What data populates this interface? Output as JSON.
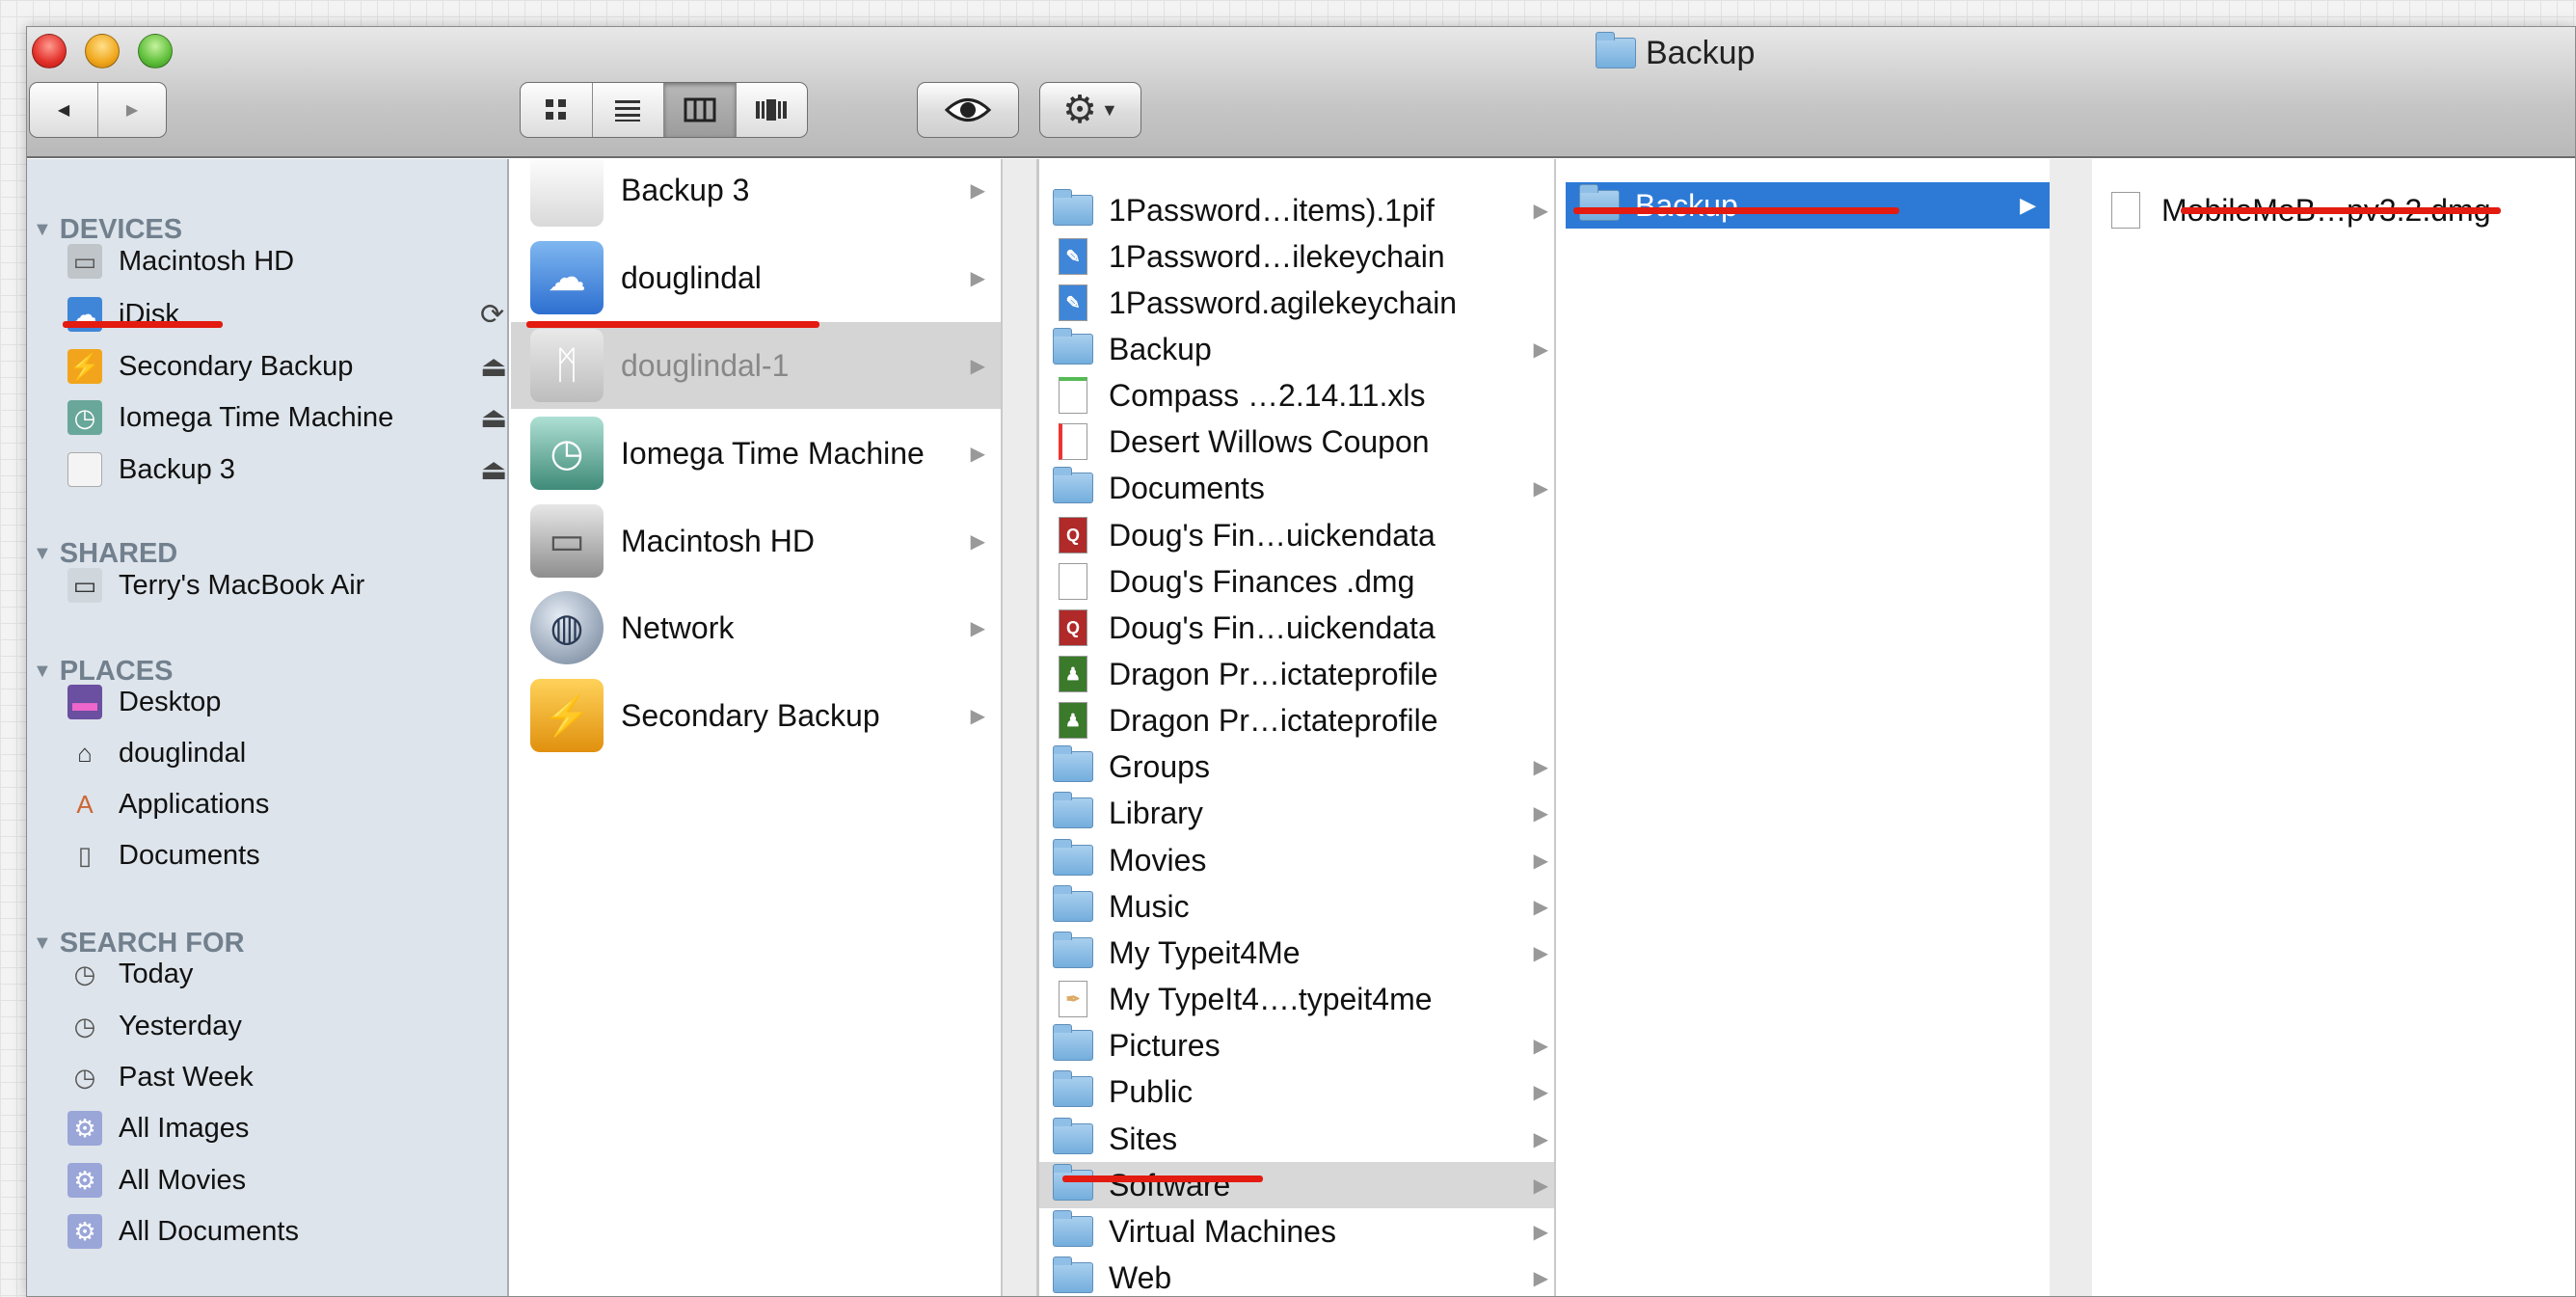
{
  "window": {
    "title": "Backup"
  },
  "toolbar": {
    "back_icon": "back-arrow-icon",
    "forward_icon": "forward-arrow-icon",
    "view_modes": [
      "icon-view",
      "list-view",
      "column-view",
      "coverflow-view"
    ],
    "quicklook_icon": "eye-icon",
    "action_icon": "gear-icon"
  },
  "sidebar": {
    "devices": {
      "header": "DEVICES",
      "items": [
        {
          "label": "Macintosh HD",
          "icon": "harddisk-icon"
        },
        {
          "label": "iDisk",
          "icon": "idisk-icon",
          "action": "⟳"
        },
        {
          "label": "Secondary Backup",
          "icon": "usb-drive-icon",
          "action": "⏏"
        },
        {
          "label": "Iomega Time Machine",
          "icon": "timemachine-drive-icon",
          "action": "⏏"
        },
        {
          "label": "Backup 3",
          "icon": "drive-icon",
          "action": "⏏"
        }
      ]
    },
    "shared": {
      "header": "SHARED",
      "items": [
        {
          "label": "Terry's MacBook Air",
          "icon": "laptop-icon"
        }
      ]
    },
    "places": {
      "header": "PLACES",
      "items": [
        {
          "label": "Desktop",
          "icon": "desktop-icon"
        },
        {
          "label": "douglindal",
          "icon": "home-icon"
        },
        {
          "label": "Applications",
          "icon": "applications-icon"
        },
        {
          "label": "Documents",
          "icon": "documents-icon"
        }
      ]
    },
    "search": {
      "header": "SEARCH FOR",
      "items": [
        {
          "label": "Today",
          "icon": "clock-icon"
        },
        {
          "label": "Yesterday",
          "icon": "clock-icon"
        },
        {
          "label": "Past Week",
          "icon": "clock-icon"
        },
        {
          "label": "All Images",
          "icon": "smart-folder-icon"
        },
        {
          "label": "All Movies",
          "icon": "smart-folder-icon"
        },
        {
          "label": "All Documents",
          "icon": "smart-folder-icon"
        }
      ]
    }
  },
  "column1": [
    {
      "label": "Backup 3",
      "icon": "drive-icon"
    },
    {
      "label": "douglindal",
      "icon": "idisk-icon"
    },
    {
      "label": "douglindal-1",
      "icon": "network-share-icon",
      "selected": true
    },
    {
      "label": "Iomega Time Machine",
      "icon": "timemachine-drive-icon"
    },
    {
      "label": "Macintosh HD",
      "icon": "harddisk-icon"
    },
    {
      "label": "Network",
      "icon": "network-globe-icon"
    },
    {
      "label": "Secondary Backup",
      "icon": "usb-drive-icon"
    }
  ],
  "column2": [
    {
      "label": "1Password…items).1pif",
      "kind": "folder",
      "arrow": true
    },
    {
      "label": "1Password…ilekeychain",
      "kind": "keychain"
    },
    {
      "label": "1Password.agilekeychain",
      "kind": "keychain"
    },
    {
      "label": "Backup",
      "kind": "folder",
      "arrow": true
    },
    {
      "label": "Compass …2.14.11.xls",
      "kind": "xls"
    },
    {
      "label": "Desert Willows Coupon",
      "kind": "pdf"
    },
    {
      "label": "Documents",
      "kind": "folder",
      "arrow": true
    },
    {
      "label": "Doug's Fin…uickendata",
      "kind": "quicken"
    },
    {
      "label": "Doug's Finances .dmg",
      "kind": "dmg"
    },
    {
      "label": "Doug's Fin…uickendata",
      "kind": "quicken"
    },
    {
      "label": "Dragon Pr…ictateprofile",
      "kind": "dragon"
    },
    {
      "label": "Dragon Pr…ictateprofile",
      "kind": "dragon"
    },
    {
      "label": "Groups",
      "kind": "folder",
      "arrow": true
    },
    {
      "label": "Library",
      "kind": "folder",
      "arrow": true
    },
    {
      "label": "Movies",
      "kind": "folder",
      "arrow": true
    },
    {
      "label": "Music",
      "kind": "folder",
      "arrow": true
    },
    {
      "label": "My Typeit4Me",
      "kind": "folder",
      "arrow": true
    },
    {
      "label": "My TypeIt4….typeit4me",
      "kind": "typeit"
    },
    {
      "label": "Pictures",
      "kind": "folder",
      "arrow": true
    },
    {
      "label": "Public",
      "kind": "folder",
      "arrow": true
    },
    {
      "label": "Sites",
      "kind": "folder",
      "arrow": true
    },
    {
      "label": "Software",
      "kind": "folder",
      "arrow": true,
      "selected": true
    },
    {
      "label": "Virtual Machines",
      "kind": "folder",
      "arrow": true
    },
    {
      "label": "Web",
      "kind": "folder",
      "arrow": true
    }
  ],
  "column3": [
    {
      "label": "Backup",
      "kind": "folder",
      "selected": true
    }
  ],
  "column4": [
    {
      "label": "MobileMeB…pv3.2.dmg",
      "kind": "dmg"
    }
  ],
  "colors": {
    "selection_blue": "#2d7ad6",
    "annotation_red": "#e31b10",
    "sidebar_bg": "#dde4eb"
  }
}
